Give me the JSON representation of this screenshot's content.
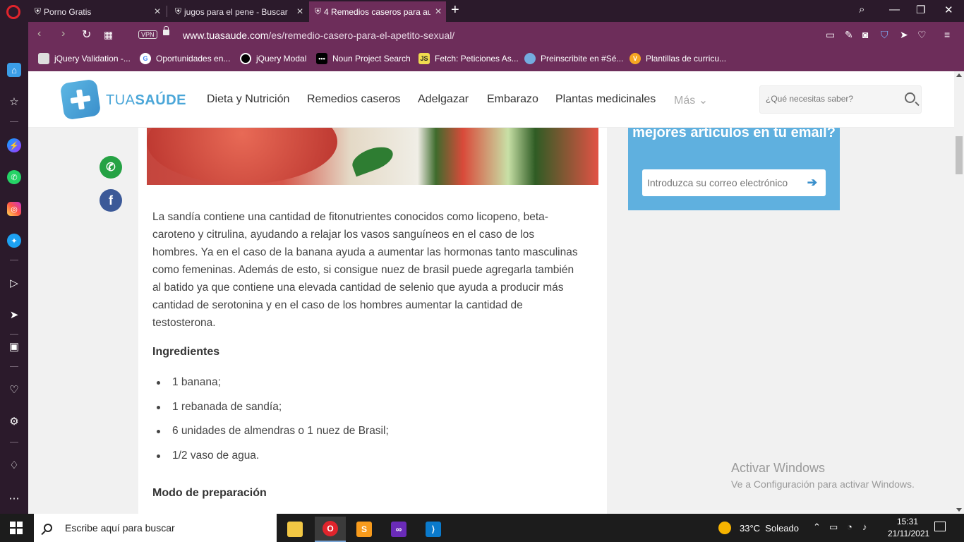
{
  "browser": {
    "tabs": [
      {
        "title": "Porno Gratis",
        "active": false
      },
      {
        "title": "jugos para el pene - Buscar",
        "active": false
      },
      {
        "title": "4 Remedios caseros para au",
        "active": true
      }
    ],
    "url_domain": "www.tuasaude.com",
    "url_path": "/es/remedio-casero-para-el-apetito-sexual/",
    "vpn_label": "VPN",
    "bookmarks": [
      {
        "label": "jQuery Validation -...",
        "icon": "jquery-validation-icon"
      },
      {
        "label": "Oportunidades en...",
        "icon": "google-icon"
      },
      {
        "label": "jQuery Modal",
        "icon": "jquery-modal-icon"
      },
      {
        "label": "Noun Project Search",
        "icon": "noun-project-icon"
      },
      {
        "label": "Fetch: Peticiones As...",
        "icon": "js-icon"
      },
      {
        "label": "Preinscribite en #Sé...",
        "icon": "flag-icon"
      },
      {
        "label": "Plantillas de curricu...",
        "icon": "cv-icon"
      }
    ],
    "js_badge": "JS"
  },
  "site": {
    "logo_light": "TUA",
    "logo_bold": "SAÚDE",
    "menu": [
      "Dieta y Nutrición",
      "Remedios caseros",
      "Adelgazar",
      "Embarazo",
      "Plantas medicinales"
    ],
    "menu_more": "Más",
    "search_placeholder": "¿Qué necesitas saber?"
  },
  "article": {
    "paragraph": "La sandía contiene una cantidad de fitonutrientes conocidos como licopeno, beta-caroteno y citrulina, ayudando a relajar los vasos sanguíneos en el caso de los hombres. Ya en el caso de la banana ayuda a aumentar las hormonas tanto masculinas como femeninas. Además de esto, si consigue nuez de brasil puede agregarla también al batido ya que contiene una elevada cantidad de selenio que ayuda a producir más cantidad de serotonina y en el caso de los hombres aumentar la cantidad de testosterona.",
    "ingredients_heading": "Ingredientes",
    "ingredients": [
      "1 banana;",
      "1 rebanada de sandía;",
      "6 unidades de almendras o 1 nuez de Brasil;",
      "1/2 vaso de agua."
    ],
    "method_heading": "Modo de preparación"
  },
  "newsletter": {
    "title": "mejores artículos en tu email?",
    "placeholder": "Introduzca su correo electrónico"
  },
  "watermark": {
    "line1": "Activar Windows",
    "line2": "Ve a Configuración para activar Windows."
  },
  "taskbar": {
    "search_text": "Escribe aquí para buscar",
    "weather_temp": "33°C",
    "weather_desc": "Soleado",
    "time": "15:31",
    "date": "21/11/2021"
  }
}
